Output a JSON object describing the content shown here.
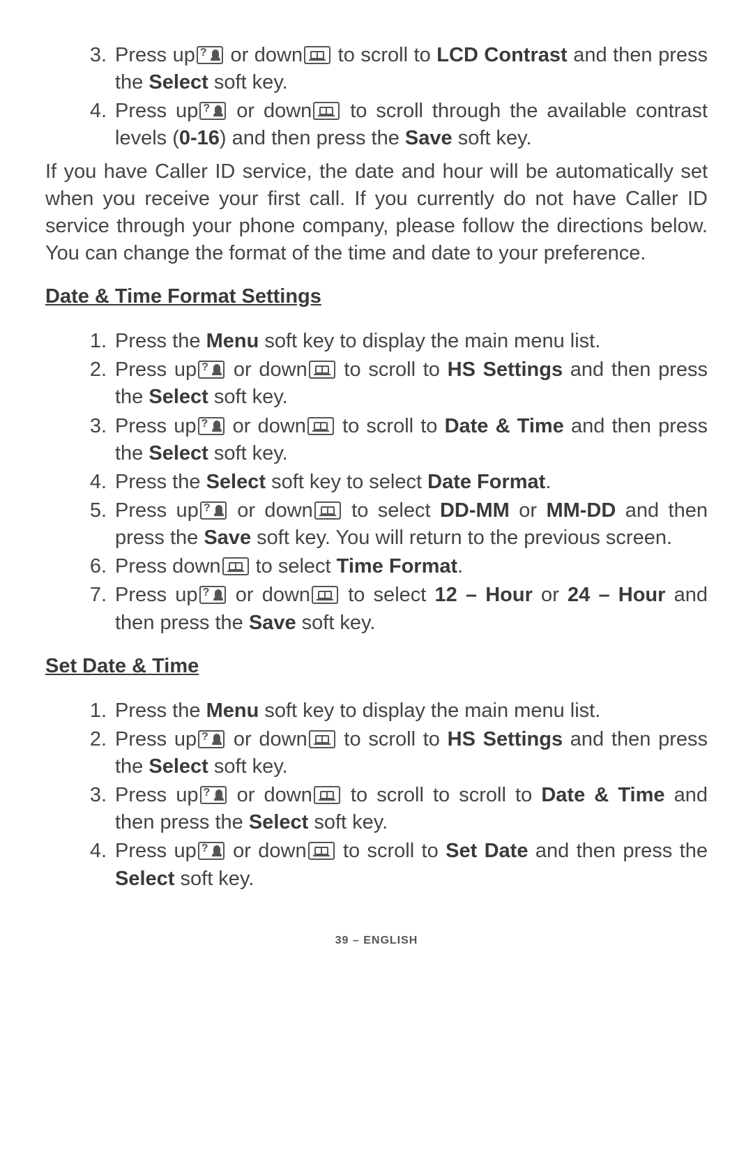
{
  "topList": [
    {
      "n": "3.",
      "parts": [
        "Press up",
        "UP",
        " or down",
        "DOWN",
        " to scroll to ",
        {
          "b": "LCD Contrast"
        },
        " and then press the ",
        {
          "b": "Select"
        },
        " soft key."
      ]
    },
    {
      "n": "4.",
      "parts": [
        "Press up",
        "UP",
        " or down",
        "DOWN",
        " to scroll through the available contrast levels (",
        {
          "b": "0-16"
        },
        ") and then press the ",
        {
          "b": "Save"
        },
        " soft key."
      ]
    }
  ],
  "para1": "If you have Caller ID service, the date and hour will be automatically set when you receive your first call. If you currently do not have Caller ID service through your phone company, please follow the directions below.  You can change the format of the time and date to your preference.",
  "head1": "Date & Time Format Settings",
  "list1": [
    {
      "n": "1.",
      "parts": [
        "Press the ",
        {
          "b": "Menu"
        },
        " soft key to display the main menu list."
      ]
    },
    {
      "n": "2.",
      "parts": [
        "Press up",
        "UP",
        " or down",
        "DOWN",
        " to scroll to ",
        {
          "b": "HS Settings"
        },
        " and then press the ",
        {
          "b": "Select"
        },
        " soft key."
      ]
    },
    {
      "n": "3.",
      "parts": [
        "Press up",
        "UP",
        " or down",
        "DOWN",
        " to scroll to ",
        {
          "b": "Date & Time"
        },
        " and then press the ",
        {
          "b": "Select"
        },
        " soft key."
      ]
    },
    {
      "n": "4.",
      "parts": [
        "Press the ",
        {
          "b": "Select"
        },
        " soft key to select ",
        {
          "b": "Date Format"
        },
        "."
      ]
    },
    {
      "n": "5.",
      "parts": [
        "Press up",
        "UP",
        " or down",
        "DOWN",
        " to select ",
        {
          "b": "DD-MM"
        },
        " or ",
        {
          "b": "MM-DD"
        },
        " and then press the ",
        {
          "b": "Save"
        },
        " soft key.  You will return to the previous screen."
      ]
    },
    {
      "n": "6.",
      "parts": [
        "Press down",
        "DOWN",
        " to select ",
        {
          "b": "Time Format"
        },
        "."
      ]
    },
    {
      "n": "7.",
      "parts": [
        "Press up",
        "UP",
        " or down",
        "DOWN",
        " to select ",
        {
          "b": "12 – Hour"
        },
        " or ",
        {
          "b": "24 – Hour"
        },
        " and then press the ",
        {
          "b": "Save"
        },
        " soft key."
      ]
    }
  ],
  "head2": "Set Date & Time ",
  "list2": [
    {
      "n": "1.",
      "parts": [
        "Press the ",
        {
          "b": "Menu"
        },
        " soft key to display the main menu list."
      ]
    },
    {
      "n": "2.",
      "parts": [
        "Press up",
        "UP",
        " or down",
        "DOWN",
        " to scroll to ",
        {
          "b": "HS Settings"
        },
        " and then press the ",
        {
          "b": "Select"
        },
        " soft key."
      ]
    },
    {
      "n": "3.",
      "parts": [
        "Press up",
        "UP",
        " or down",
        "DOWN",
        " to scroll to scroll to ",
        {
          "b": "Date & Time"
        },
        " and then press the ",
        {
          "b": "Select"
        },
        " soft key."
      ]
    },
    {
      "n": "4.",
      "parts": [
        "Press up",
        "UP",
        " or down",
        "DOWN",
        " to scroll to ",
        {
          "b": "Set Date"
        },
        " and then press the ",
        {
          "b": "Select"
        },
        " soft key."
      ]
    }
  ],
  "footer": "39 – ENGLISH"
}
